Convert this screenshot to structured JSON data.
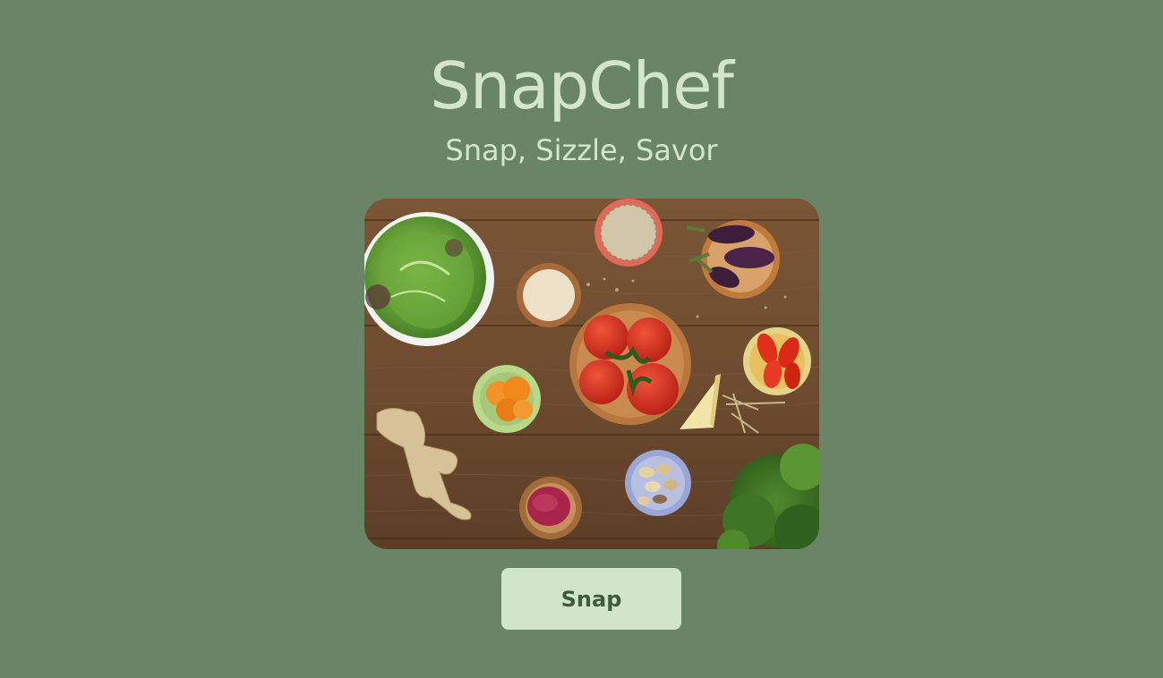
{
  "app": {
    "title": "SnapChef",
    "tagline": "Snap, Sizzle, Savor"
  },
  "hero_image": {
    "description_name": "ingredients-on-wooden-table-photo"
  },
  "actions": {
    "snap_label": "Snap"
  },
  "colors": {
    "background": "#6a8566",
    "title_text": "#d3e6cb",
    "button_bg": "#d1e5c9",
    "button_text": "#3e5c3b"
  }
}
